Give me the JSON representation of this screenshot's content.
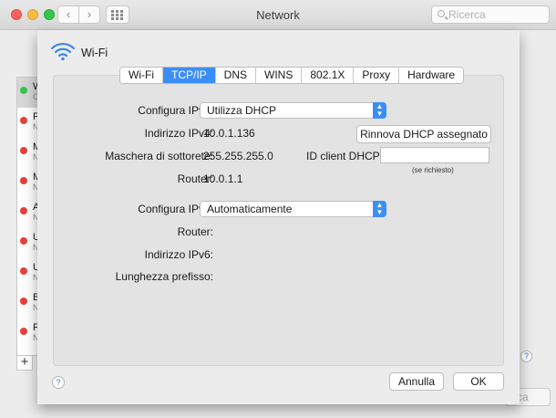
{
  "window": {
    "title": "Network",
    "search_placeholder": "Ricerca",
    "back_glyph": "‹",
    "forward_glyph": "›"
  },
  "services_bg": [
    {
      "initial": "W",
      "sub": "C",
      "status_color": "#34c84a",
      "selected": true
    },
    {
      "initial": "P",
      "sub": "N",
      "status_color": "#e6403a"
    },
    {
      "initial": "M",
      "sub": "N",
      "status_color": "#e6403a"
    },
    {
      "initial": "M",
      "sub": "N",
      "status_color": "#e6403a"
    },
    {
      "initial": "A",
      "sub": "N",
      "status_color": "#e6403a"
    },
    {
      "initial": "U",
      "sub": "N",
      "status_color": "#e6403a"
    },
    {
      "initial": "U",
      "sub": "N",
      "status_color": "#e6403a"
    },
    {
      "initial": "B",
      "sub": "N",
      "status_color": "#e6403a"
    },
    {
      "initial": "F",
      "sub": "N",
      "status_color": "#e6403a"
    }
  ],
  "background_controls": {
    "add_label": "+",
    "help_label": "?",
    "partial_button_label": "ca"
  },
  "sheet": {
    "interface_name": "Wi-Fi",
    "tabs": [
      "Wi-Fi",
      "TCP/IP",
      "DNS",
      "WINS",
      "802.1X",
      "Proxy",
      "Hardware"
    ],
    "active_tab": "TCP/IP",
    "ipv4": {
      "configure_label": "Configura IPv4:",
      "configure_value": "Utilizza DHCP",
      "address_label": "Indirizzo IPv4:",
      "address_value": "10.0.1.136",
      "renew_button": "Rinnova DHCP assegnato",
      "subnet_label": "Maschera di sottorete:",
      "subnet_value": "255.255.255.0",
      "client_id_label": "ID client DHCP:",
      "client_id_value": "",
      "client_id_hint": "(se richiesto)",
      "router_label": "Router:",
      "router_value": "10.0.1.1"
    },
    "ipv6": {
      "configure_label": "Configura IPv6:",
      "configure_value": "Automaticamente",
      "router_label": "Router:",
      "address_label": "Indirizzo IPv6:",
      "prefix_label": "Lunghezza prefisso:"
    },
    "help_label": "?",
    "cancel_button": "Annulla",
    "ok_button": "OK"
  },
  "colors": {
    "accent": "#3c8ef7",
    "wifi_icon": "#3a86e8",
    "status_on": "#34c84a",
    "status_off": "#e6403a"
  }
}
